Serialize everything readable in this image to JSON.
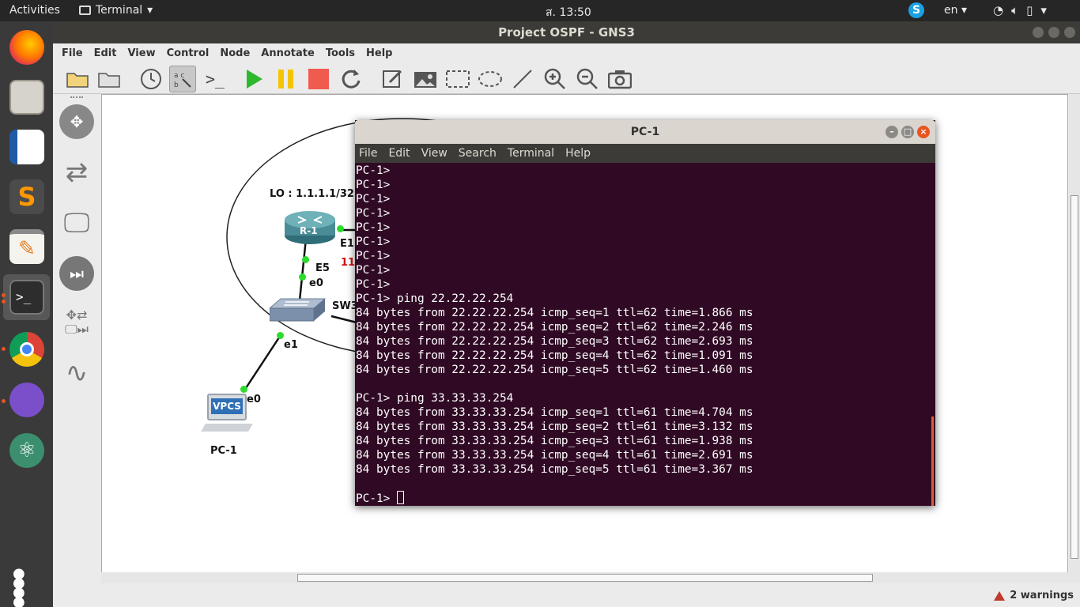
{
  "topbar": {
    "activities": "Activities",
    "app_name": "Terminal",
    "clock": "ส. 13:50",
    "lang": "en"
  },
  "launcher": {
    "apps": [
      "Firefox",
      "Files",
      "LibreOffice Writer",
      "Sublime Text",
      "Text Editor",
      "Terminal",
      "Chrome",
      "GNS3",
      "Atom",
      "Show Applications"
    ]
  },
  "gns3": {
    "title": "Project OSPF - GNS3",
    "menu": [
      "File",
      "Edit",
      "View",
      "Control",
      "Node",
      "Annotate",
      "Tools",
      "Help"
    ],
    "status_warnings": "2 warnings"
  },
  "topology": {
    "loopback_label": "LO : 1.1.1.1/32",
    "router_name": "R-1",
    "router_if_right": "E1",
    "router_if_down": "E5",
    "red_partial": "11",
    "switch_name": "SW3",
    "switch_if_top": "e0",
    "switch_if_bottom": "e1",
    "pc_name": "PC-1",
    "pc_if": "e0",
    "pc_badge": "VPCS"
  },
  "terminal": {
    "title": "PC-1",
    "menu": [
      "File",
      "Edit",
      "View",
      "Search",
      "Terminal",
      "Help"
    ],
    "lines": [
      "PC-1>",
      "PC-1>",
      "PC-1>",
      "PC-1>",
      "PC-1>",
      "PC-1>",
      "PC-1>",
      "PC-1>",
      "PC-1>",
      "PC-1> ping 22.22.22.254",
      "84 bytes from 22.22.22.254 icmp_seq=1 ttl=62 time=1.866 ms",
      "84 bytes from 22.22.22.254 icmp_seq=2 ttl=62 time=2.246 ms",
      "84 bytes from 22.22.22.254 icmp_seq=3 ttl=62 time=2.693 ms",
      "84 bytes from 22.22.22.254 icmp_seq=4 ttl=62 time=1.091 ms",
      "84 bytes from 22.22.22.254 icmp_seq=5 ttl=62 time=1.460 ms",
      "",
      "PC-1> ping 33.33.33.254",
      "84 bytes from 33.33.33.254 icmp_seq=1 ttl=61 time=4.704 ms",
      "84 bytes from 33.33.33.254 icmp_seq=2 ttl=61 time=3.132 ms",
      "84 bytes from 33.33.33.254 icmp_seq=3 ttl=61 time=1.938 ms",
      "84 bytes from 33.33.33.254 icmp_seq=4 ttl=61 time=2.691 ms",
      "84 bytes from 33.33.33.254 icmp_seq=5 ttl=61 time=3.367 ms",
      ""
    ],
    "prompt": "PC-1> "
  }
}
